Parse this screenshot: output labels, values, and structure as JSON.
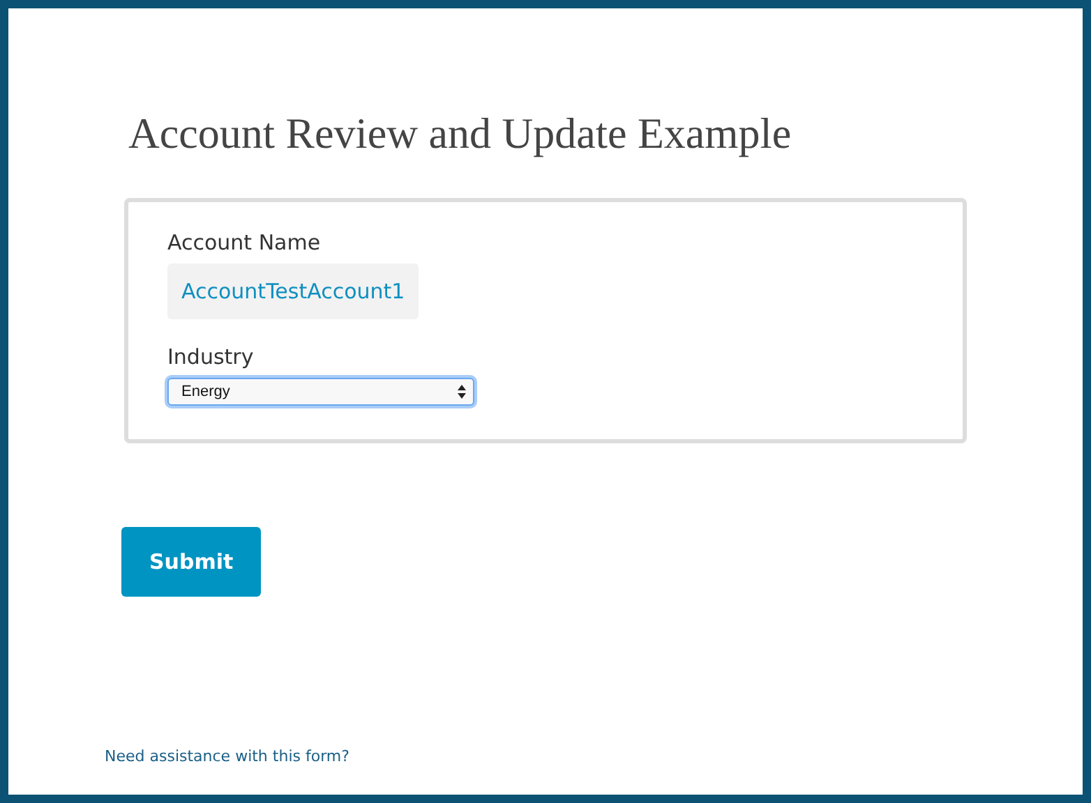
{
  "title": "Account Review and Update Example",
  "fields": [
    {
      "kind": "readonly",
      "label": "Account Name",
      "value": "AccountTestAccount1"
    },
    {
      "kind": "select",
      "label": "Industry",
      "value": "Energy"
    }
  ],
  "submit": "Submit",
  "help_link": "Need assistance with this form?"
}
